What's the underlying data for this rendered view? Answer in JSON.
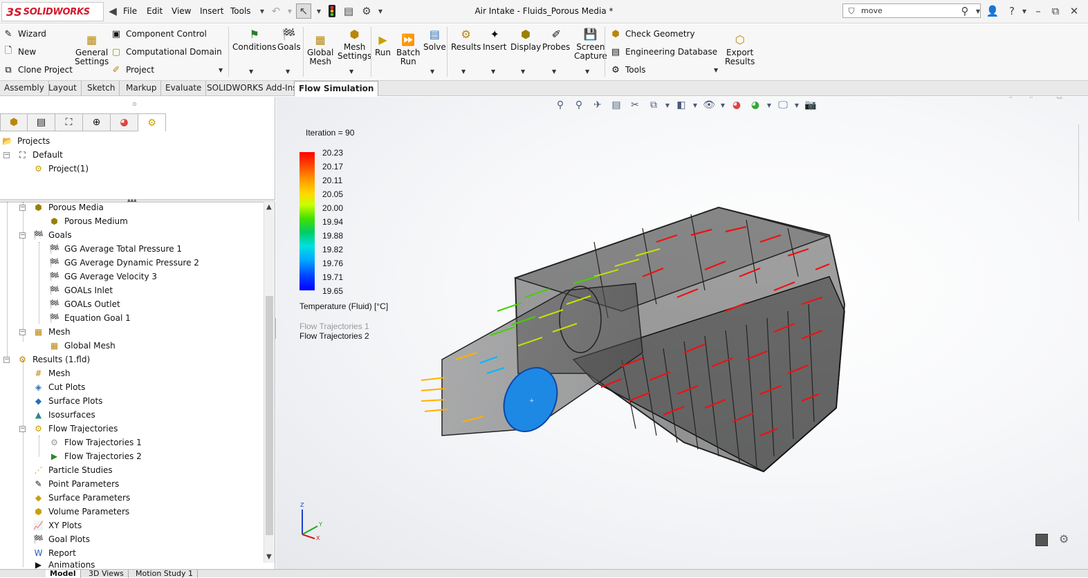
{
  "app": {
    "logo_mark": "3S",
    "logo_text": "SOLIDWORKS",
    "document_title": "Air Intake - Fluids_Porous Media *",
    "menu": [
      "File",
      "Edit",
      "View",
      "Insert",
      "Tools"
    ],
    "search_value": "move"
  },
  "toolbar": {
    "left_column": [
      "Wizard",
      "New",
      "Clone Project"
    ],
    "general_settings": [
      "General",
      "Settings"
    ],
    "middle_column": [
      "Component Control",
      "Computational Domain",
      "Project"
    ],
    "conditions": "Conditions",
    "goals": "Goals",
    "global_mesh": [
      "Global",
      "Mesh"
    ],
    "mesh_settings": [
      "Mesh",
      "Settings"
    ],
    "run": "Run",
    "batch_run": [
      "Batch",
      "Run"
    ],
    "solve": "Solve",
    "results": "Results",
    "insert": "Insert",
    "display": "Display",
    "probes": "Probes",
    "screen_capture": [
      "Screen",
      "Capture"
    ],
    "right_column": [
      "Check Geometry",
      "Engineering Database",
      "Tools"
    ],
    "export_results": [
      "Export",
      "Results"
    ]
  },
  "tabs": [
    {
      "label": "Assembly",
      "active": false
    },
    {
      "label": "Layout",
      "active": false
    },
    {
      "label": "Sketch",
      "active": false
    },
    {
      "label": "Markup",
      "active": false
    },
    {
      "label": "Evaluate",
      "active": false
    },
    {
      "label": "SOLIDWORKS Add-Ins",
      "active": false
    },
    {
      "label": "Flow Simulation",
      "active": true
    }
  ],
  "top_tree": {
    "projects": "Projects",
    "default": "Default",
    "project1": "Project(1)"
  },
  "tree": {
    "porous_media": "Porous Media",
    "porous_medium": "Porous Medium",
    "goals": "Goals",
    "goal1": "GG Average Total Pressure 1",
    "goal2": "GG Average Dynamic Pressure 2",
    "goal3": "GG Average Velocity 3",
    "goal4": "GOALs Inlet",
    "goal5": "GOALs Outlet",
    "goal6": "Equation Goal 1",
    "mesh": "Mesh",
    "global_mesh": "Global Mesh",
    "results": "Results (1.fld)",
    "r_mesh": "Mesh",
    "cut_plots": "Cut Plots",
    "surface_plots": "Surface Plots",
    "isosurfaces": "Isosurfaces",
    "flow_traj": "Flow Trajectories",
    "flow_traj1": "Flow Trajectories 1",
    "flow_traj2": "Flow Trajectories 2",
    "particle": "Particle Studies",
    "point_params": "Point Parameters",
    "surface_params": "Surface Parameters",
    "volume_params": "Volume Parameters",
    "xy_plots": "XY Plots",
    "goal_plots": "Goal Plots",
    "report": "Report",
    "animations": "Animations"
  },
  "bottom_tabs": [
    "Model",
    "3D Views",
    "Motion Study 1"
  ],
  "viewport": {
    "iteration": "Iteration = 90",
    "legend_ticks": [
      "20.23",
      "20.17",
      "20.11",
      "20.05",
      "20.00",
      "19.94",
      "19.88",
      "19.82",
      "19.76",
      "19.71",
      "19.65"
    ],
    "legend_title": "Temperature (Fluid) [°C]",
    "trajectories": [
      "Flow Trajectories 1",
      "Flow Trajectories 2"
    ],
    "triad": {
      "z": "Z",
      "y": "Y",
      "x": "X"
    }
  },
  "colors": {
    "brand_red": "#d6172a",
    "inlet_blue": "#1e88e5",
    "arrow_red": "#ee1111"
  }
}
